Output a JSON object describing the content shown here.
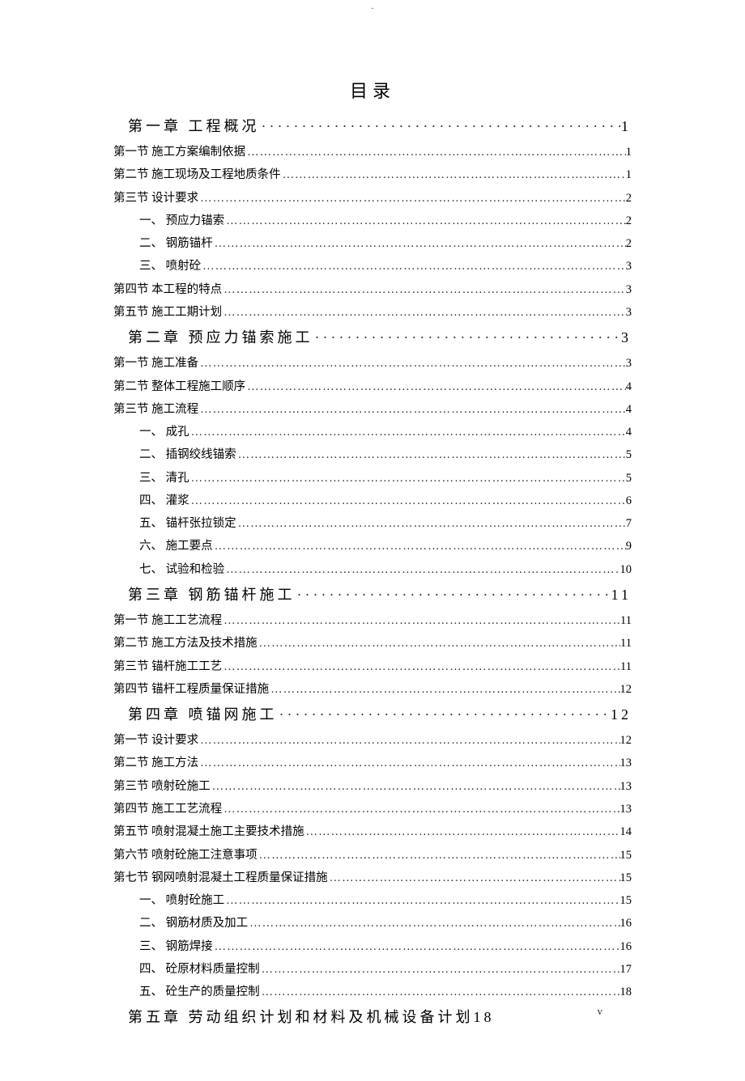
{
  "title": "目录",
  "footer_page": "v",
  "dots_thin": "……………………………………………………………………………………………………………………………………",
  "dots_thick": "·····································································",
  "toc": [
    {
      "type": "chapter",
      "label": "第一章 工程概况",
      "page": "1"
    },
    {
      "type": "section",
      "label": "第一节 施工方案编制依据",
      "page": "1"
    },
    {
      "type": "section",
      "label": "第二节 施工现场及工程地质条件",
      "page": "1"
    },
    {
      "type": "section",
      "label": "第三节 设计要求",
      "page": "2"
    },
    {
      "type": "sub",
      "label": "一、 预应力锚索",
      "page": "2"
    },
    {
      "type": "sub",
      "label": "二、 钢筋锚杆",
      "page": "2"
    },
    {
      "type": "sub",
      "label": "三、 喷射砼",
      "page": "3"
    },
    {
      "type": "section",
      "label": "第四节 本工程的特点",
      "page": "3"
    },
    {
      "type": "section",
      "label": "第五节 施工工期计划",
      "page": "3"
    },
    {
      "type": "chapter",
      "label": "第二章 预应力锚索施工",
      "page": "3"
    },
    {
      "type": "section",
      "label": "第一节 施工准备",
      "page": "3"
    },
    {
      "type": "section",
      "label": "第二节 整体工程施工顺序",
      "page": "4"
    },
    {
      "type": "section",
      "label": "第三节 施工流程",
      "page": "4"
    },
    {
      "type": "sub",
      "label": "一、 成孔",
      "page": "4"
    },
    {
      "type": "sub",
      "label": "二、 插钢绞线锚索",
      "page": "5"
    },
    {
      "type": "sub",
      "label": "三、 清孔",
      "page": "5"
    },
    {
      "type": "sub",
      "label": "四、 灌浆",
      "page": "6"
    },
    {
      "type": "sub",
      "label": "五、 锚杆张拉锁定",
      "page": "7"
    },
    {
      "type": "sub",
      "label": "六、 施工要点",
      "page": "9"
    },
    {
      "type": "sub",
      "label": "七、 试验和检验",
      "page": "10"
    },
    {
      "type": "chapter",
      "label": "第三章 钢筋锚杆施工",
      "page": "11"
    },
    {
      "type": "section",
      "label": "第一节 施工工艺流程",
      "page": "11"
    },
    {
      "type": "section",
      "label": "第二节 施工方法及技术措施",
      "page": "11"
    },
    {
      "type": "section",
      "label": "第三节 锚杆施工工艺",
      "page": "11"
    },
    {
      "type": "section",
      "label": "第四节 锚杆工程质量保证措施",
      "page": "12"
    },
    {
      "type": "chapter",
      "label": "第四章 喷锚网施工",
      "page": "12"
    },
    {
      "type": "section",
      "label": "第一节 设计要求",
      "page": "12"
    },
    {
      "type": "section",
      "label": "第二节 施工方法",
      "page": "13"
    },
    {
      "type": "section",
      "label": "第三节 喷射砼施工",
      "page": "13"
    },
    {
      "type": "section",
      "label": "第四节 施工工艺流程",
      "page": "13"
    },
    {
      "type": "section",
      "label": "第五节 喷射混凝土施工主要技术措施",
      "page": "14"
    },
    {
      "type": "section",
      "label": "第六节 喷射砼施工注意事项",
      "page": "15"
    },
    {
      "type": "section",
      "label": "第七节 钢网喷射混凝土工程质量保证措施",
      "page": "15"
    },
    {
      "type": "sub",
      "label": "一、 喷射砼施工",
      "page": "15"
    },
    {
      "type": "sub",
      "label": "二、 钢筋材质及加工",
      "page": "16"
    },
    {
      "type": "sub",
      "label": "三、 钢筋焊接",
      "page": "16"
    },
    {
      "type": "sub",
      "label": "四、 砼原材料质量控制",
      "page": "17"
    },
    {
      "type": "sub",
      "label": "五、 砼生产的质量控制",
      "page": "18"
    },
    {
      "type": "chapter",
      "label": "第五章 劳动组织计划和材料及机械设备计划",
      "page": "18",
      "nodots": true
    }
  ]
}
